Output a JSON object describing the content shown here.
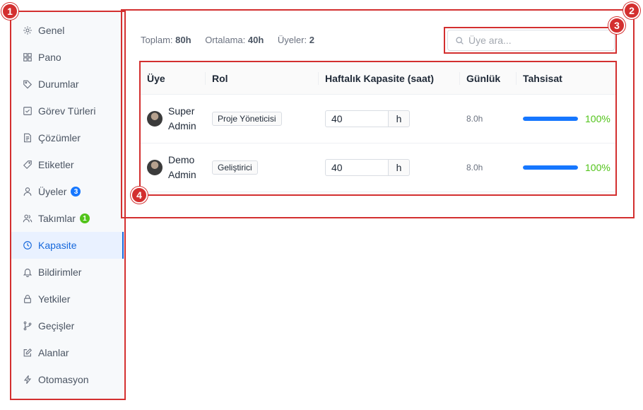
{
  "sidebar": {
    "items": [
      {
        "label": "Genel",
        "icon": "gear-icon"
      },
      {
        "label": "Pano",
        "icon": "grid-icon"
      },
      {
        "label": "Durumlar",
        "icon": "tag-icon"
      },
      {
        "label": "Görev Türleri",
        "icon": "checkbox-icon"
      },
      {
        "label": "Çözümler",
        "icon": "document-icon"
      },
      {
        "label": "Etiketler",
        "icon": "label-icon"
      },
      {
        "label": "Üyeler",
        "icon": "user-icon",
        "badge": "3",
        "badge_color": "#1677ff"
      },
      {
        "label": "Takımlar",
        "icon": "team-icon",
        "badge": "1",
        "badge_color": "#52c41a"
      },
      {
        "label": "Kapasite",
        "icon": "clock-icon",
        "active": true
      },
      {
        "label": "Bildirimler",
        "icon": "bell-icon"
      },
      {
        "label": "Yetkiler",
        "icon": "lock-icon"
      },
      {
        "label": "Geçişler",
        "icon": "branch-icon"
      },
      {
        "label": "Alanlar",
        "icon": "edit-icon"
      },
      {
        "label": "Otomasyon",
        "icon": "lightning-icon"
      }
    ]
  },
  "stats": {
    "total_label": "Toplam:",
    "total_value": "80h",
    "average_label": "Ortalama:",
    "average_value": "40h",
    "members_label": "Üyeler:",
    "members_value": "2"
  },
  "search": {
    "placeholder": "Üye ara..."
  },
  "table": {
    "headers": [
      "Üye",
      "Rol",
      "Haftalık Kapasite (saat)",
      "Günlük",
      "Tahsisat"
    ],
    "rows": [
      {
        "name_line1": "Super",
        "name_line2": "Admin",
        "role": "Proje Yöneticisi",
        "capacity": "40",
        "unit": "h",
        "daily": "8.0h",
        "allocation": "100%",
        "allocation_fraction": 1.0
      },
      {
        "name_line1": "Demo",
        "name_line2": "Admin",
        "role": "Geliştirici",
        "capacity": "40",
        "unit": "h",
        "daily": "8.0h",
        "allocation": "100%",
        "allocation_fraction": 1.0
      }
    ]
  },
  "annotations": [
    "1",
    "2",
    "3",
    "4"
  ],
  "colors": {
    "accent": "#1668dc",
    "annotation": "#d32f2f",
    "success": "#52c41a"
  }
}
